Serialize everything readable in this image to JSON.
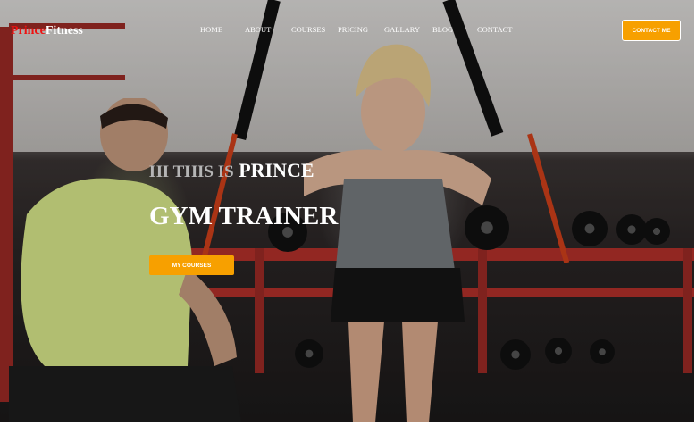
{
  "brand": {
    "part1": "Prince",
    "part2": "Fitness"
  },
  "nav": {
    "items": [
      "HOME",
      "ABOUT",
      "COURSES",
      "PRICING",
      "GALLARY",
      "BLOG",
      "CONTACT"
    ],
    "contact_button": "CONTACT ME"
  },
  "hero": {
    "greeting_prefix": "HI THIS IS",
    "greeting_name": "PRINCE",
    "title": "GYM TRAINER",
    "cta_label": "MY COURSES"
  },
  "colors": {
    "accent": "#f7a000",
    "brand_red": "#ee1111"
  }
}
